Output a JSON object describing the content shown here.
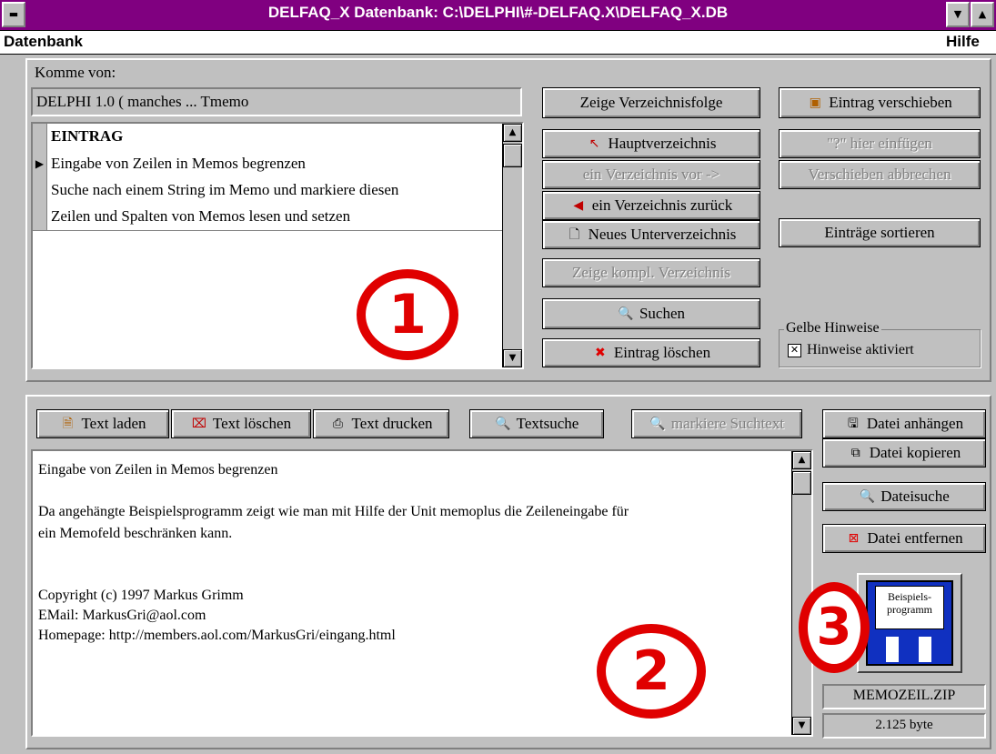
{
  "window": {
    "title": "DELFAQ_X  Datenbank: C:\\DELPHI\\#-DELFAQ.X\\DELFAQ_X.DB"
  },
  "menu": {
    "left": "Datenbank",
    "right": "Hilfe"
  },
  "top": {
    "komme_label": "Komme von:",
    "komme_value": "DELPHI 1.0 ( manches ... Tmemo",
    "list_header": "EINTRAG",
    "list_items": [
      "Eingabe von Zeilen in Memos begrenzen",
      "Suche nach einem String im Memo und markiere diesen",
      "Zeilen und Spalten von Memos lesen und setzen"
    ],
    "buttons": {
      "zeige_folge": "Zeige Verzeichnisfolge",
      "hauptverzeichnis": "Hauptverzeichnis",
      "verzeichnis_vor": "ein Verzeichnis vor ->",
      "verzeichnis_zurueck": "ein Verzeichnis zurück",
      "neues_unter": "Neues Unterverzeichnis",
      "zeige_kompl": "Zeige kompl. Verzeichnis",
      "suchen": "Suchen",
      "eintrag_loeschen": "Eintrag löschen",
      "eintrag_verschieben": "Eintrag verschieben",
      "hier_einfuegen": "\"?\" hier einfügen",
      "verschieben_abbrechen": "Verschieben abbrechen",
      "eintraege_sortieren": "Einträge sortieren"
    },
    "gelbe_hinweise": {
      "title": "Gelbe Hinweise",
      "checkbox": "Hinweise aktiviert",
      "checked": true
    }
  },
  "bottom": {
    "toolbar": {
      "text_laden": "Text laden",
      "text_loeschen": "Text löschen",
      "text_drucken": "Text drucken",
      "textsuche": "Textsuche",
      "markiere": "markiere Suchtext"
    },
    "memo_lines": [
      "Eingabe von Zeilen in Memos begrenzen",
      "",
      "Da angehängte Beispielsprogramm zeigt wie man mit Hilfe der Unit memoplus die Zeileneingabe für",
      "ein Memofeld beschränken kann.",
      "",
      "",
      "Copyright (c) 1997 Markus Grimm",
      "EMail: MarkusGri@aol.com",
      "Homepage: http://members.aol.com/MarkusGri/eingang.html"
    ],
    "file_buttons": {
      "anhaengen": "Datei anhängen",
      "kopieren": "Datei kopieren",
      "dateisuche": "Dateisuche",
      "entfernen": "Datei entfernen"
    },
    "attachment": {
      "icon_label": "Beispiels-programm",
      "filename": "MEMOZEIL.ZIP",
      "size": "2.125 byte"
    }
  },
  "annotations": [
    "1",
    "2",
    "3"
  ],
  "colors": {
    "titlebar": "#800080",
    "annotation_red": "#e00000",
    "face": "#c0c0c0"
  }
}
